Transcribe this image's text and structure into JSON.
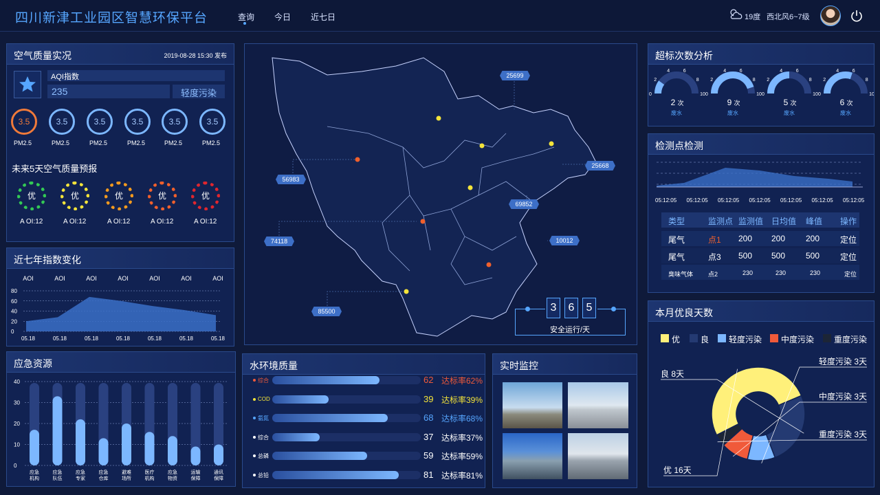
{
  "header": {
    "title": "四川新津工业园区智慧环保平台",
    "nav": [
      "查询",
      "今日",
      "近七日"
    ],
    "temp": "19度",
    "wind": "西北风6~7级"
  },
  "air": {
    "title": "空气质量实况",
    "published": "2019-08-28 15:30 发布",
    "aqi_label": "AQI指数",
    "aqi_value": "235",
    "aqi_level": "轻度污染",
    "pollutants": [
      {
        "value": "3.5",
        "name": "PM2.5"
      },
      {
        "value": "3.5",
        "name": "PM2.5"
      },
      {
        "value": "3.5",
        "name": "PM2.5"
      },
      {
        "value": "3.5",
        "name": "PM2.5"
      },
      {
        "value": "3.5",
        "name": "PM2.5"
      },
      {
        "value": "3.5",
        "name": "PM2.5"
      }
    ],
    "forecast_title": "未来5天空气质量预报",
    "forecast": [
      {
        "level": "优",
        "label": "A OI:12",
        "color": "#33c955"
      },
      {
        "level": "优",
        "label": "A OI:12",
        "color": "#f4e43a"
      },
      {
        "level": "优",
        "label": "A OI:12",
        "color": "#f39a1e"
      },
      {
        "level": "优",
        "label": "A OI:12",
        "color": "#f0602c"
      },
      {
        "level": "优",
        "label": "A OI:12",
        "color": "#e0262e"
      }
    ]
  },
  "seven": {
    "title": "近七年指数变化",
    "series_labels": [
      "AOI",
      "AOI",
      "AOI",
      "AOI",
      "AOI",
      "AOI",
      "AOI"
    ],
    "x": [
      "05.18",
      "05.18",
      "05.18",
      "05.18",
      "05.18",
      "05.18",
      "05.18"
    ],
    "yticks": [
      "80",
      "60",
      "40",
      "20",
      "0"
    ],
    "ylim": [
      0,
      80
    ],
    "values": [
      20,
      28,
      68,
      60,
      50,
      42,
      32
    ]
  },
  "emergency": {
    "title": "应急资源",
    "yticks": [
      "40",
      "30",
      "20",
      "10",
      "0"
    ],
    "ylim": [
      0,
      40
    ],
    "categories": [
      "应急\n机构",
      "应急\n队伍",
      "应急\n专家",
      "应急\n仓库",
      "避难\n场所",
      "医疗\n机构",
      "应急\n物资",
      "运输\n保障",
      "通讯\n保障"
    ],
    "values": [
      17,
      33,
      22,
      13,
      20,
      16,
      14,
      9,
      10
    ]
  },
  "water": {
    "title": "水环境质量",
    "rows": [
      {
        "label": "综合",
        "value": "62",
        "rate": "达标率62%",
        "pct": 0.72,
        "color": "#f05a3a"
      },
      {
        "label": "COD",
        "value": "39",
        "rate": "达标率39%",
        "pct": 0.38,
        "color": "#f4e43a"
      },
      {
        "label": "氨氮",
        "value": "68",
        "rate": "达标率68%",
        "pct": 0.78,
        "color": "#56a6ff"
      },
      {
        "label": "综合",
        "value": "37",
        "rate": "达标率37%",
        "pct": 0.32,
        "color": "#ffffff"
      },
      {
        "label": "总磷",
        "value": "59",
        "rate": "达标率59%",
        "pct": 0.64,
        "color": "#ffffff"
      },
      {
        "label": "总铅",
        "value": "81",
        "rate": "达标率81%",
        "pct": 0.85,
        "color": "#ffffff"
      }
    ]
  },
  "monitor": {
    "title": "实时监控"
  },
  "map": {
    "labels": [
      "25699",
      "25668",
      "56983",
      "69852",
      "74118",
      "10012",
      "85500"
    ],
    "safety_digits": [
      "3",
      "6",
      "5"
    ],
    "safety_label": "安全运行/天"
  },
  "exceed": {
    "title": "超标次数分析",
    "gauges": [
      {
        "count": "2",
        "unit": "次",
        "type": "废水",
        "pct": 0.2
      },
      {
        "count": "9",
        "unit": "次",
        "type": "废水",
        "pct": 0.9
      },
      {
        "count": "5",
        "unit": "次",
        "type": "废水",
        "pct": 0.5
      },
      {
        "count": "6",
        "unit": "次",
        "type": "废水",
        "pct": 0.6
      }
    ],
    "ticks": [
      "0",
      "2",
      "4",
      "6",
      "8",
      "10"
    ]
  },
  "detect": {
    "title": "检测点检测",
    "times": [
      "05:12:05",
      "05:12:05",
      "05:12:05",
      "05:12:05",
      "05:12:05",
      "05:12:05",
      "05:12:05"
    ],
    "headers": [
      "类型",
      "监测点",
      "监测值",
      "日均值",
      "峰值",
      "操作"
    ],
    "rows": [
      [
        "尾气",
        "点1",
        "200",
        "200",
        "200",
        "定位"
      ],
      [
        "尾气",
        "点3",
        "500",
        "500",
        "500",
        "定位"
      ],
      [
        "臭味气体",
        "点2",
        "230",
        "230",
        "230",
        "定位"
      ]
    ]
  },
  "good": {
    "title": "本月优良天数",
    "legend": [
      {
        "label": "优",
        "color": "#fff07a"
      },
      {
        "label": "良",
        "color": "#243a72"
      },
      {
        "label": "轻度污染",
        "color": "#7cb7ff"
      },
      {
        "label": "中度污染",
        "color": "#f05a3a"
      },
      {
        "label": "重度污染",
        "color": "#1c2536"
      }
    ],
    "slices": [
      {
        "label": "优 16天",
        "value": 16
      },
      {
        "label": "良 8天",
        "value": 8
      },
      {
        "label": "轻度污染 3天",
        "value": 3
      },
      {
        "label": "中度污染 3天",
        "value": 3
      },
      {
        "label": "重度污染 3天",
        "value": 1.3
      }
    ]
  }
}
